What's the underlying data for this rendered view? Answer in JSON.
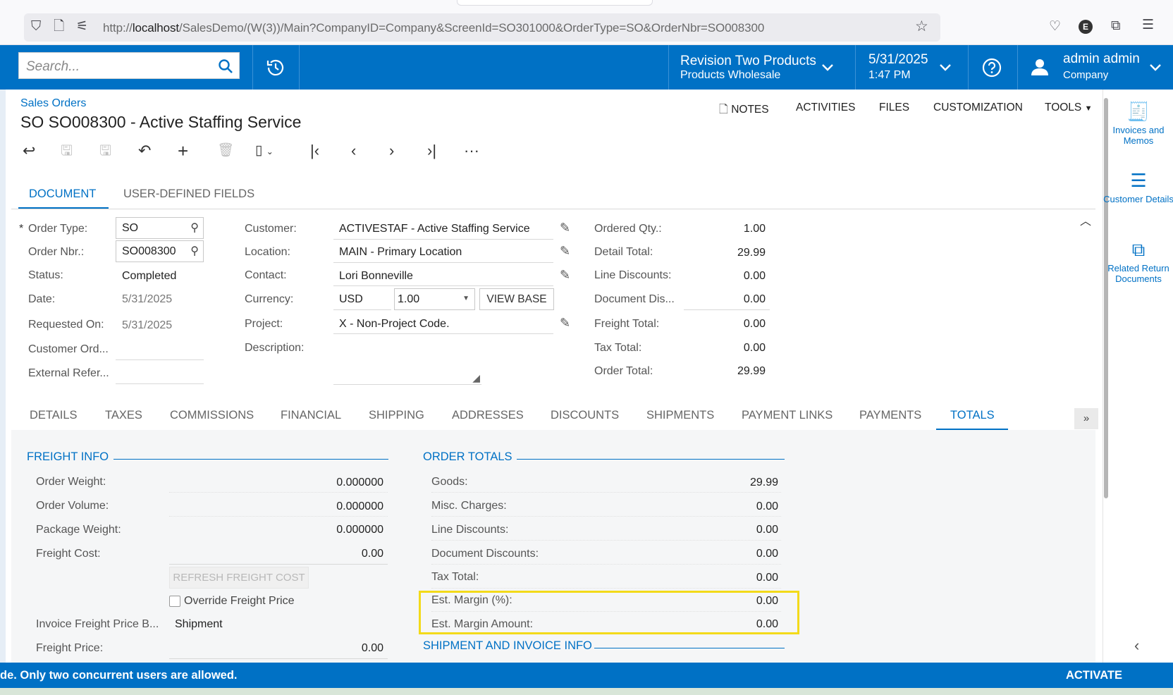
{
  "browser": {
    "url_prefix": "http://",
    "url_host": "localhost",
    "url_path": "/SalesDemo/(W(3))/Main?CompanyID=Company&ScreenId=SO301000&OrderType=SO&OrderNbr=SO008300"
  },
  "header": {
    "search_placeholder": "Search...",
    "branch_name": "Revision Two Products",
    "branch_sub": "Products Wholesale",
    "date": "5/31/2025",
    "time": "1:47 PM",
    "user_name": "admin admin",
    "user_company": "Company",
    "accent": "#0071c5"
  },
  "page": {
    "breadcrumb": "Sales Orders",
    "title": "SO SO008300 - Active Staffing Service",
    "menu": {
      "notes": "NOTES",
      "activities": "ACTIVITIES",
      "files": "FILES",
      "customization": "CUSTOMIZATION",
      "tools": "TOOLS"
    }
  },
  "right_panel": {
    "invoices": "Invoices and Memos",
    "customer": "Customer Details",
    "related": "Related Return Documents"
  },
  "top_tabs": {
    "document": "DOCUMENT",
    "udf": "USER-DEFINED FIELDS"
  },
  "form": {
    "order_type_label": "Order Type:",
    "order_type": "SO",
    "required_mark": "*",
    "order_nbr_label": "Order Nbr.:",
    "order_nbr": "SO008300",
    "status_label": "Status:",
    "status": "Completed",
    "date_label": "Date:",
    "date": "5/31/2025",
    "requested_label": "Requested On:",
    "requested": "5/31/2025",
    "customer_ord_label": "Customer Ord...",
    "external_ref_label": "External Refer...",
    "customer_label": "Customer:",
    "customer": "ACTIVESTAF - Active Staffing Service",
    "location_label": "Location:",
    "location": "MAIN - Primary Location",
    "contact_label": "Contact:",
    "contact": "Lori Bonneville",
    "currency_label": "Currency:",
    "currency": "USD",
    "rate": "1.00",
    "view_base": "VIEW BASE",
    "project_label": "Project:",
    "project": "X - Non-Project Code.",
    "description_label": "Description:",
    "ordered_qty_label": "Ordered Qty.:",
    "ordered_qty": "1.00",
    "detail_total_label": "Detail Total:",
    "detail_total": "29.99",
    "line_disc_label": "Line Discounts:",
    "line_disc": "0.00",
    "doc_disc_label": "Document Dis...",
    "doc_disc": "0.00",
    "freight_total_label": "Freight Total:",
    "freight_total": "0.00",
    "tax_total_label": "Tax Total:",
    "tax_total": "0.00",
    "order_total_label": "Order Total:",
    "order_total": "29.99"
  },
  "detail_tabs": [
    "DETAILS",
    "TAXES",
    "COMMISSIONS",
    "FINANCIAL",
    "SHIPPING",
    "ADDRESSES",
    "DISCOUNTS",
    "SHIPMENTS",
    "PAYMENT LINKS",
    "PAYMENTS",
    "TOTALS"
  ],
  "freight": {
    "header": "FREIGHT INFO",
    "order_weight_label": "Order Weight:",
    "order_weight": "0.000000",
    "order_volume_label": "Order Volume:",
    "order_volume": "0.000000",
    "package_weight_label": "Package Weight:",
    "package_weight": "0.000000",
    "freight_cost_label": "Freight Cost:",
    "freight_cost": "0.00",
    "refresh_button": "REFRESH FREIGHT COST",
    "override_label": "Override Freight Price",
    "invoice_fp_label": "Invoice Freight Price B...",
    "invoice_fp": "Shipment",
    "freight_price_label": "Freight Price:",
    "freight_price": "0.00"
  },
  "totals": {
    "header": "ORDER TOTALS",
    "goods_label": "Goods:",
    "goods": "29.99",
    "misc_label": "Misc. Charges:",
    "misc": "0.00",
    "line_disc_label": "Line Discounts:",
    "line_disc": "0.00",
    "doc_disc_label": "Document Discounts:",
    "doc_disc": "0.00",
    "tax_label": "Tax Total:",
    "tax": "0.00",
    "margin_pct_label": "Est. Margin (%):",
    "margin_pct": "0.00",
    "margin_amt_label": "Est. Margin Amount:",
    "margin_amt": "0.00",
    "shipment_header": "SHIPMENT AND INVOICE INFO"
  },
  "footer": {
    "message": "de. Only two concurrent users are allowed.",
    "activate": "ACTIVATE"
  }
}
